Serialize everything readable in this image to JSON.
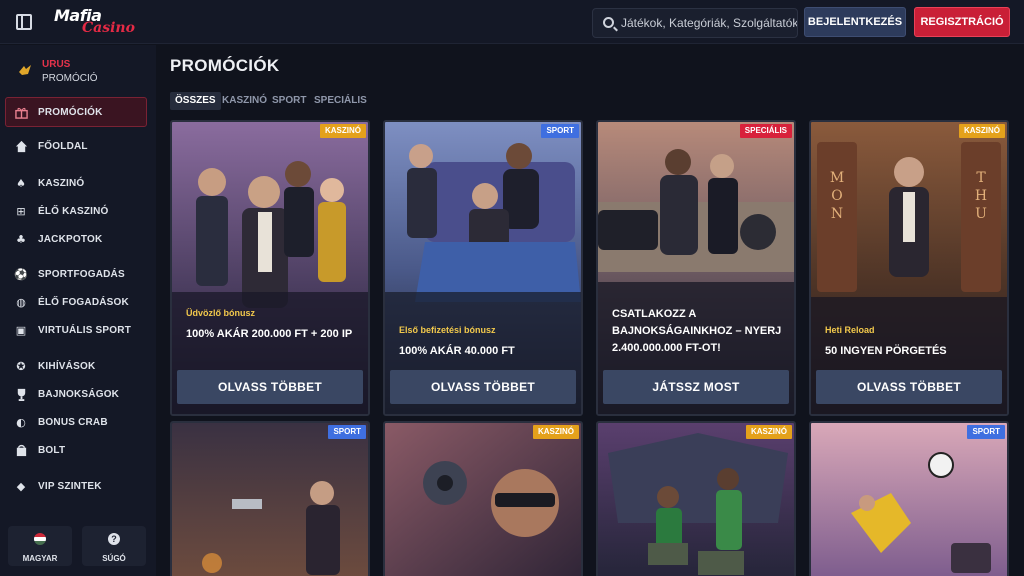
{
  "header": {
    "logo_main": "Mafia",
    "logo_sub": "Casino",
    "search_placeholder": "Játékok, Kategóriák, Szolgáltatók",
    "login_label": "BEJELENTKEZÉS",
    "register_label": "REGISZTRÁCIÓ"
  },
  "sidebar": {
    "hero_title": "URUS",
    "hero_sub": "PROMÓCIÓ",
    "active_label": "PROMÓCIÓK",
    "items": [
      {
        "label": "FŐOLDAL",
        "icon": "home-icon"
      },
      {
        "label": "KASZINÓ",
        "icon": "spade-icon"
      },
      {
        "label": "ÉLŐ KASZINÓ",
        "icon": "live-casino-icon"
      },
      {
        "label": "JACKPOTOK",
        "icon": "clover-icon"
      },
      {
        "label": "SPORTFOGADÁS",
        "icon": "ball-icon"
      },
      {
        "label": "ÉLŐ FOGADÁSOK",
        "icon": "live-bet-icon"
      },
      {
        "label": "VIRTUÁLIS SPORT",
        "icon": "virtual-sport-icon"
      },
      {
        "label": "KIHÍVÁSOK",
        "icon": "challenge-icon"
      },
      {
        "label": "BAJNOKSÁGOK",
        "icon": "trophy-icon"
      },
      {
        "label": "BONUS CRAB",
        "icon": "crab-icon"
      },
      {
        "label": "BOLT",
        "icon": "shop-icon"
      },
      {
        "label": "VIP SZINTEK",
        "icon": "diamond-icon"
      }
    ],
    "language_label": "MAGYAR",
    "help_label": "SÚGÓ"
  },
  "main": {
    "title": "PROMÓCIÓK",
    "tabs": [
      "ÖSSZES",
      "KASZINÓ",
      "SPORT",
      "SPECIÁLIS"
    ],
    "active_tab": "ÖSSZES",
    "cards": [
      {
        "badge": "KASZINÓ",
        "subtitle": "Üdvözlő bónusz",
        "title": "100% AKÁR 200.000 FT + 200 IP",
        "button": "OLVASS TÖBBET"
      },
      {
        "badge": "SPORT",
        "subtitle": "Első befizetési bónusz",
        "title": "100% AKÁR 40.000 FT",
        "button": "OLVASS TÖBBET"
      },
      {
        "badge": "SPECIÁLIS",
        "subtitle": "",
        "title": "CSATLAKOZZ A BAJNOKSÁGAINKHOZ – NYERJ 2.400.000.000 FT-OT!",
        "button": "JÁTSSZ MOST"
      },
      {
        "badge": "KASZINÓ",
        "subtitle": "Heti Reload",
        "title": "50 INGYEN PÖRGETÉS",
        "button": "OLVASS TÖBBET"
      },
      {
        "badge": "SPORT"
      },
      {
        "badge": "KASZINÓ"
      },
      {
        "badge": "KASZINÓ"
      },
      {
        "badge": "SPORT"
      }
    ]
  },
  "colors": {
    "accent_red": "#c91f37",
    "badge_kaszino": "#e4a11b",
    "badge_sport": "#3f6fe0",
    "badge_specialis": "#d8213b"
  }
}
